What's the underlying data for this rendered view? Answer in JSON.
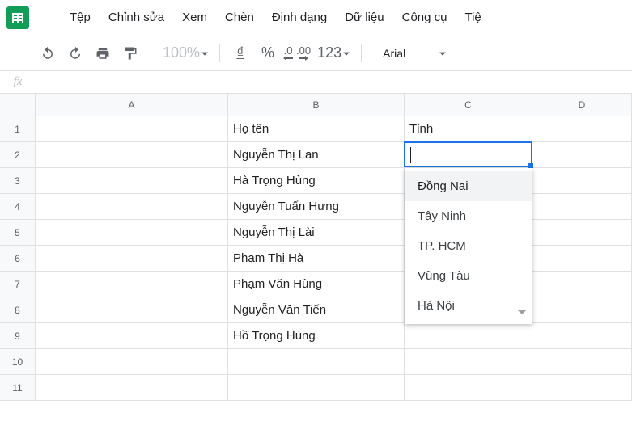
{
  "menu": {
    "items": [
      "Tệp",
      "Chỉnh sửa",
      "Xem",
      "Chèn",
      "Định dạng",
      "Dữ liệu",
      "Công cụ",
      "Tiệ"
    ]
  },
  "toolbar": {
    "zoom": "100%",
    "currency_symbol": "₫",
    "percent": "%",
    "dec_dec": ".0",
    "dec_inc": ".00",
    "numfmt": "123",
    "font": "Arial"
  },
  "columns": [
    "A",
    "B",
    "C",
    "D"
  ],
  "rows": [
    1,
    2,
    3,
    4,
    5,
    6,
    7,
    8,
    9,
    10,
    11
  ],
  "cells": {
    "b1": "Họ tên",
    "c1": "Tỉnh",
    "b2": "Nguyễn Thị Lan",
    "b3": "Hà Trọng Hùng",
    "b4": "Nguyễn Tuấn Hưng",
    "b5": "Nguyễn Thị Lài",
    "b6": "Phạm Thị Hà",
    "b7": "Phạm Văn Hùng",
    "b8": "Nguyễn Văn Tiến",
    "b9": "Hồ Trọng Hùng"
  },
  "active_cell": "C2",
  "dropdown": {
    "options": [
      "Đồng Nai",
      "Tây Ninh",
      "TP. HCM",
      "Vũng Tàu",
      "Hà Nội"
    ]
  }
}
